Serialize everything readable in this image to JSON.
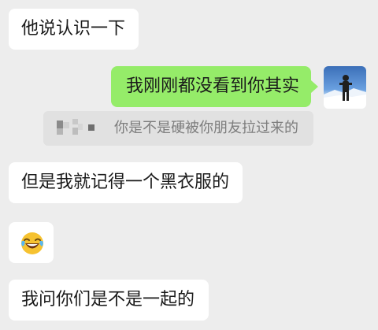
{
  "chat": {
    "messages": [
      {
        "side": "left",
        "text": "他说认识一下"
      },
      {
        "side": "right",
        "text": "我刚刚都没看到你其实"
      },
      {
        "side": "left",
        "text": "但是我就记得一个黑衣服的"
      },
      {
        "side": "left",
        "emoji": "laughing-crying-emoji"
      },
      {
        "side": "left",
        "text": "我问你们是不是一起的"
      }
    ],
    "quote": {
      "text": "你是不是硬被你朋友拉过来的"
    }
  },
  "colors": {
    "background": "#ededed",
    "incoming_bubble": "#ffffff",
    "outgoing_bubble": "#95ec69",
    "quote_background": "#e1e1e1",
    "quote_text": "#7d7d7d"
  },
  "icons": {
    "avatar": "avatar-photo",
    "emoji": "laughing-crying-emoji"
  }
}
